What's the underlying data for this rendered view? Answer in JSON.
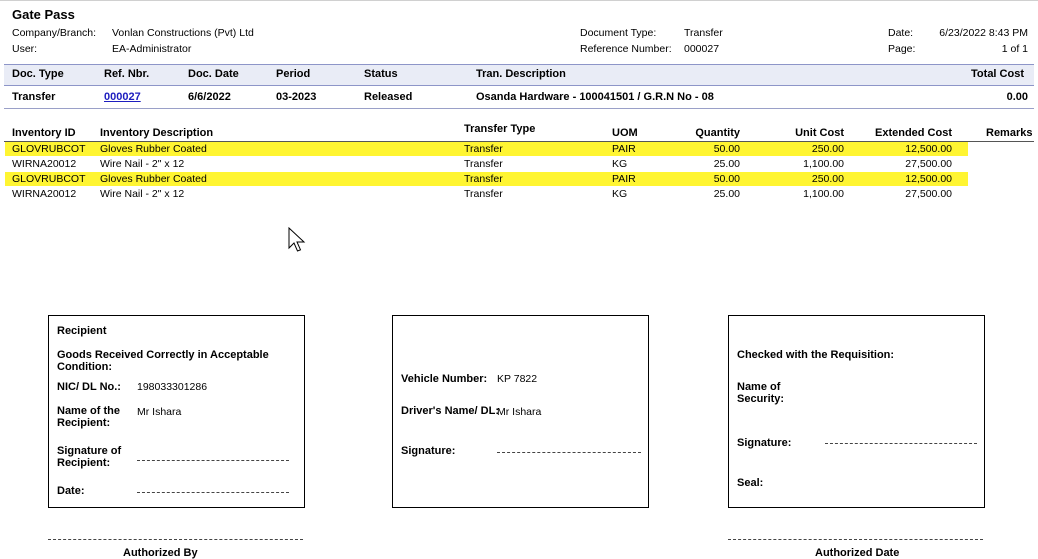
{
  "header": {
    "title": "Gate Pass",
    "company_label": "Company/Branch:",
    "company_value": "Vonlan Constructions (Pvt) Ltd",
    "user_label": "User:",
    "user_value": "EA-Administrator",
    "doc_type_label": "Document Type:",
    "doc_type_value": "Transfer",
    "ref_label": "Reference Number:",
    "ref_value": "000027",
    "date_label": "Date:",
    "date_value": "6/23/2022 8:43 PM",
    "page_label": "Page:",
    "page_value": "1 of 1"
  },
  "doc_table": {
    "headers": [
      "Doc. Type",
      "Ref. Nbr.",
      "Doc. Date",
      "Period",
      "Status",
      "Tran. Description",
      "Total Cost"
    ],
    "row": {
      "doc_type": "Transfer",
      "ref_nbr": "000027",
      "doc_date": "6/6/2022",
      "period": "03-2023",
      "status": "Released",
      "description": "Osanda Hardware - 100041501 / G.R.N No - 08",
      "total_cost": "0.00"
    }
  },
  "inventory": {
    "headers": [
      "Inventory ID",
      "Inventory Description",
      "Transfer Type",
      "UOM",
      "Quantity",
      "Unit Cost",
      "Extended Cost",
      "Remarks"
    ],
    "rows": [
      {
        "id": "GLOVRUBCOT",
        "desc": "Gloves Rubber Coated",
        "type": "Transfer",
        "uom": "PAIR",
        "qty": "50.00",
        "unit": "250.00",
        "ext": "12,500.00",
        "remarks": "",
        "highlight": true
      },
      {
        "id": "WIRNA20012",
        "desc": "Wire Nail - 2\" x 12",
        "type": "Transfer",
        "uom": "KG",
        "qty": "25.00",
        "unit": "1,100.00",
        "ext": "27,500.00",
        "remarks": "",
        "highlight": false
      },
      {
        "id": "GLOVRUBCOT",
        "desc": "Gloves Rubber Coated",
        "type": "Transfer",
        "uom": "PAIR",
        "qty": "50.00",
        "unit": "250.00",
        "ext": "12,500.00",
        "remarks": "",
        "highlight": true
      },
      {
        "id": "WIRNA20012",
        "desc": "Wire Nail - 2\" x 12",
        "type": "Transfer",
        "uom": "KG",
        "qty": "25.00",
        "unit": "1,100.00",
        "ext": "27,500.00",
        "remarks": "",
        "highlight": false
      }
    ]
  },
  "recipient_box": {
    "title": "Recipient",
    "condition_line1": "Goods Received Correctly in Acceptable",
    "condition_line2": "Condition:",
    "nic_label": "NIC/ DL No.:",
    "nic_value": "198033301286",
    "name_label_1": "Name of the",
    "name_label_2": "Recipient:",
    "name_value": "Mr Ishara",
    "sig_label_1": "Signature of",
    "sig_label_2": "Recipient:",
    "date_label": "Date:"
  },
  "vehicle_box": {
    "vehicle_label": "Vehicle Number:",
    "vehicle_value": "KP 7822",
    "driver_label": "Driver's Name/ DL:",
    "driver_value": "Mr Ishara",
    "sig_label": "Signature:"
  },
  "security_box": {
    "checked_label": "Checked with the Requisition:",
    "name_label_1": "Name of",
    "name_label_2": "Security:",
    "sig_label": "Signature:",
    "seal_label": "Seal:"
  },
  "footer": {
    "authorized_by": "Authorized By",
    "authorized_date": "Authorized Date"
  }
}
